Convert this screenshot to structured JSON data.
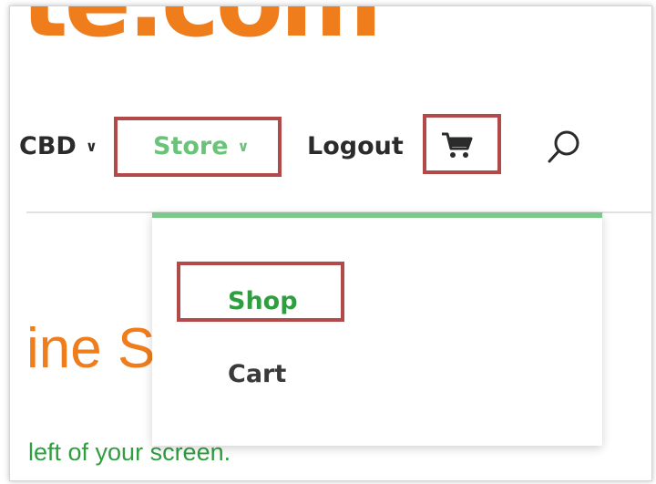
{
  "brand": {
    "logo_text": "te.com"
  },
  "nav": {
    "cbd_label": "CBD",
    "store_label": "Store",
    "logout_label": "Logout"
  },
  "dropdown": {
    "items": [
      {
        "label": "Shop"
      },
      {
        "label": "Cart"
      }
    ]
  },
  "hero": {
    "title": "ine S",
    "subtitle": "left of your screen."
  },
  "colors": {
    "brand_orange": "#f07d1c",
    "accent_green": "#6bc37a",
    "text_green": "#2e9e3f",
    "highlight_red": "#b24a4a"
  },
  "icons": {
    "cart": "cart-icon",
    "search": "search-icon",
    "chevron": "chevron-down-icon"
  }
}
